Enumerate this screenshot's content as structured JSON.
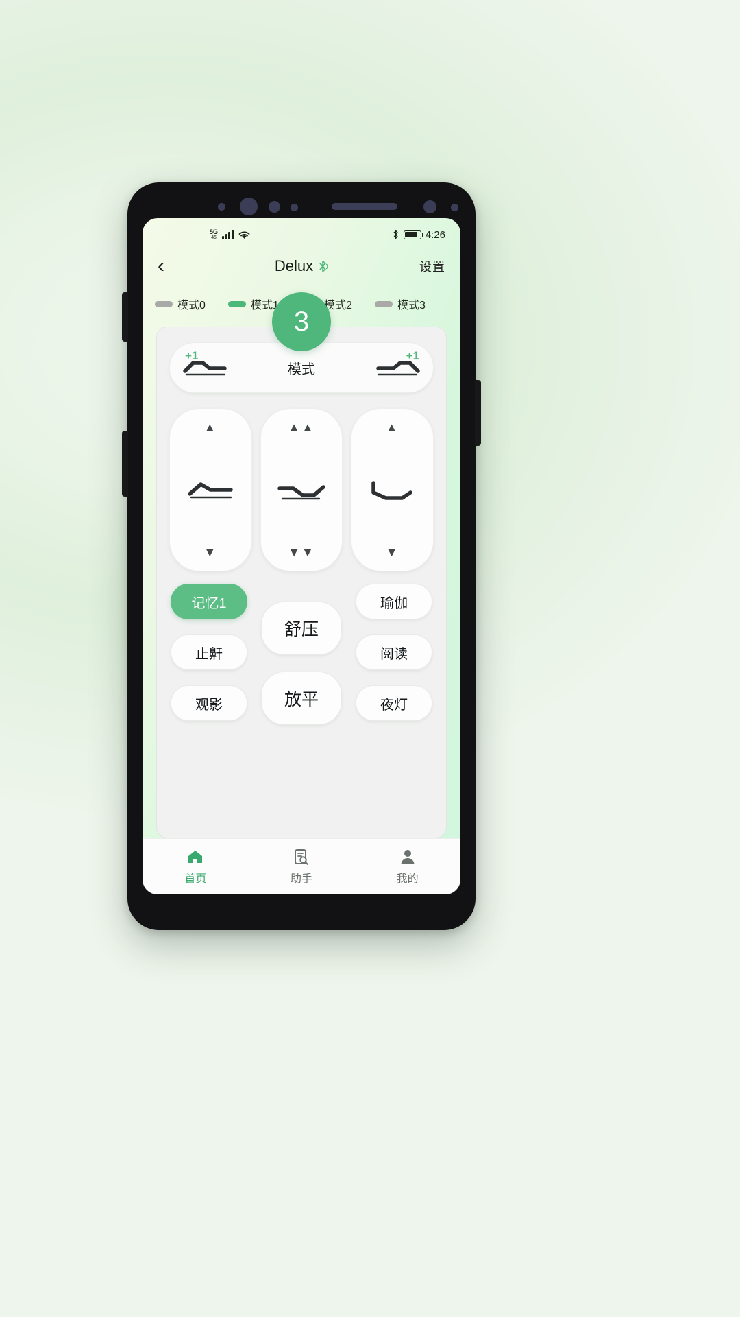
{
  "status_bar": {
    "network_label": "5G",
    "network_sub": "45",
    "signal_icon": "signal-bars-icon",
    "wifi_icon": "wifi-icon",
    "bluetooth_icon": "bluetooth-icon",
    "battery_icon": "battery-icon",
    "time": "4:26"
  },
  "app_bar": {
    "back_icon": "chevron-left-icon",
    "title": "Delux",
    "bluetooth_icon": "bluetooth-icon",
    "settings_label": "设置"
  },
  "mode_row": {
    "badge": "3",
    "items": [
      {
        "label": "模式0",
        "active": false
      },
      {
        "label": "模式1",
        "active": true
      },
      {
        "label": "模式2",
        "active": false
      },
      {
        "label": "模式3",
        "active": false
      }
    ]
  },
  "mode_bar": {
    "left_plus": "+1",
    "label": "模式",
    "right_plus": "+1",
    "left_icon": "recliner-head-up-icon",
    "right_icon": "recliner-foot-up-icon"
  },
  "controls": [
    {
      "name": "head",
      "up": "▲",
      "down": "▼",
      "icon": "bed-head-icon"
    },
    {
      "name": "both",
      "up": "▲▲",
      "down": "▼▼",
      "icon": "bed-full-icon"
    },
    {
      "name": "foot",
      "up": "▲",
      "down": "▼",
      "icon": "bed-foot-icon"
    }
  ],
  "presets": {
    "left": [
      {
        "label": "记忆1",
        "active": true
      },
      {
        "label": "止鼾",
        "active": false
      },
      {
        "label": "观影",
        "active": false
      }
    ],
    "middle": [
      {
        "label": "舒压",
        "active": false
      },
      {
        "label": "放平",
        "active": false
      }
    ],
    "right": [
      {
        "label": "瑜伽",
        "active": false
      },
      {
        "label": "阅读",
        "active": false
      },
      {
        "label": "夜灯",
        "active": false
      }
    ]
  },
  "bottom_nav": [
    {
      "label": "首页",
      "icon": "home-icon",
      "active": true
    },
    {
      "label": "助手",
      "icon": "assistant-search-icon",
      "active": false
    },
    {
      "label": "我的",
      "icon": "person-icon",
      "active": false
    }
  ],
  "colors": {
    "accent": "#4fb77c",
    "accent_dark": "#3aa96d",
    "inactive_pill": "#a9aaa8",
    "card_bg": "#f0f1f0",
    "text": "#15181a"
  }
}
